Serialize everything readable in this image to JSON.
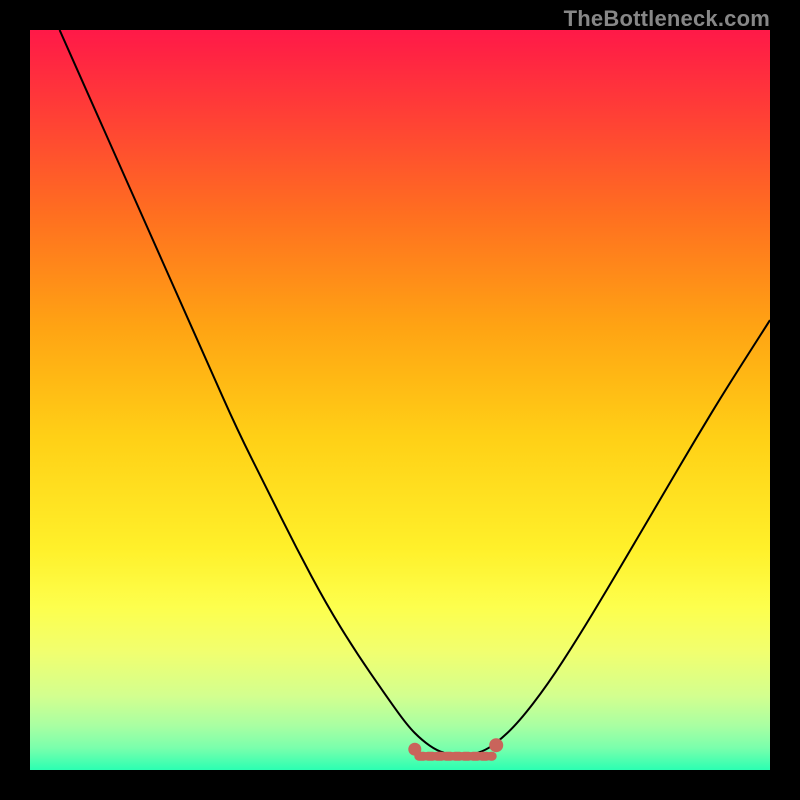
{
  "watermark": "TheBottleneck.com",
  "colors": {
    "frame": "#000000",
    "curve": "#000000",
    "marker_fill": "#c9645b",
    "marker_stroke": "#c9645b",
    "gradient_stops": [
      {
        "offset": 0.0,
        "color": "#ff1948"
      },
      {
        "offset": 0.1,
        "color": "#ff3a38"
      },
      {
        "offset": 0.25,
        "color": "#ff6f20"
      },
      {
        "offset": 0.4,
        "color": "#ffa313"
      },
      {
        "offset": 0.55,
        "color": "#ffd016"
      },
      {
        "offset": 0.7,
        "color": "#fff02a"
      },
      {
        "offset": 0.78,
        "color": "#fdff4d"
      },
      {
        "offset": 0.84,
        "color": "#f1ff6f"
      },
      {
        "offset": 0.9,
        "color": "#d3ff8f"
      },
      {
        "offset": 0.94,
        "color": "#a9ffa2"
      },
      {
        "offset": 0.97,
        "color": "#7affac"
      },
      {
        "offset": 1.0,
        "color": "#2bffb2"
      }
    ]
  },
  "chart_data": {
    "type": "line",
    "title": "",
    "xlabel": "",
    "ylabel": "",
    "xlim": [
      0,
      100
    ],
    "ylim": [
      0,
      100
    ],
    "x": [
      4,
      8,
      12,
      16,
      20,
      24,
      28,
      32,
      36,
      40,
      44,
      48,
      51,
      53,
      55,
      57,
      59,
      61,
      63,
      66,
      70,
      74,
      78,
      82,
      86,
      90,
      94,
      100
    ],
    "values": [
      100,
      91,
      82,
      73,
      64,
      55,
      46,
      38,
      30,
      22.5,
      16,
      10.2,
      6.0,
      4.0,
      2.6,
      2.0,
      2.0,
      2.4,
      3.6,
      6.4,
      11.6,
      17.8,
      24.4,
      31.2,
      38.0,
      44.8,
      51.4,
      60.8
    ],
    "highlight_region": {
      "x_start": 52,
      "x_end": 63,
      "y": 2.0
    }
  }
}
